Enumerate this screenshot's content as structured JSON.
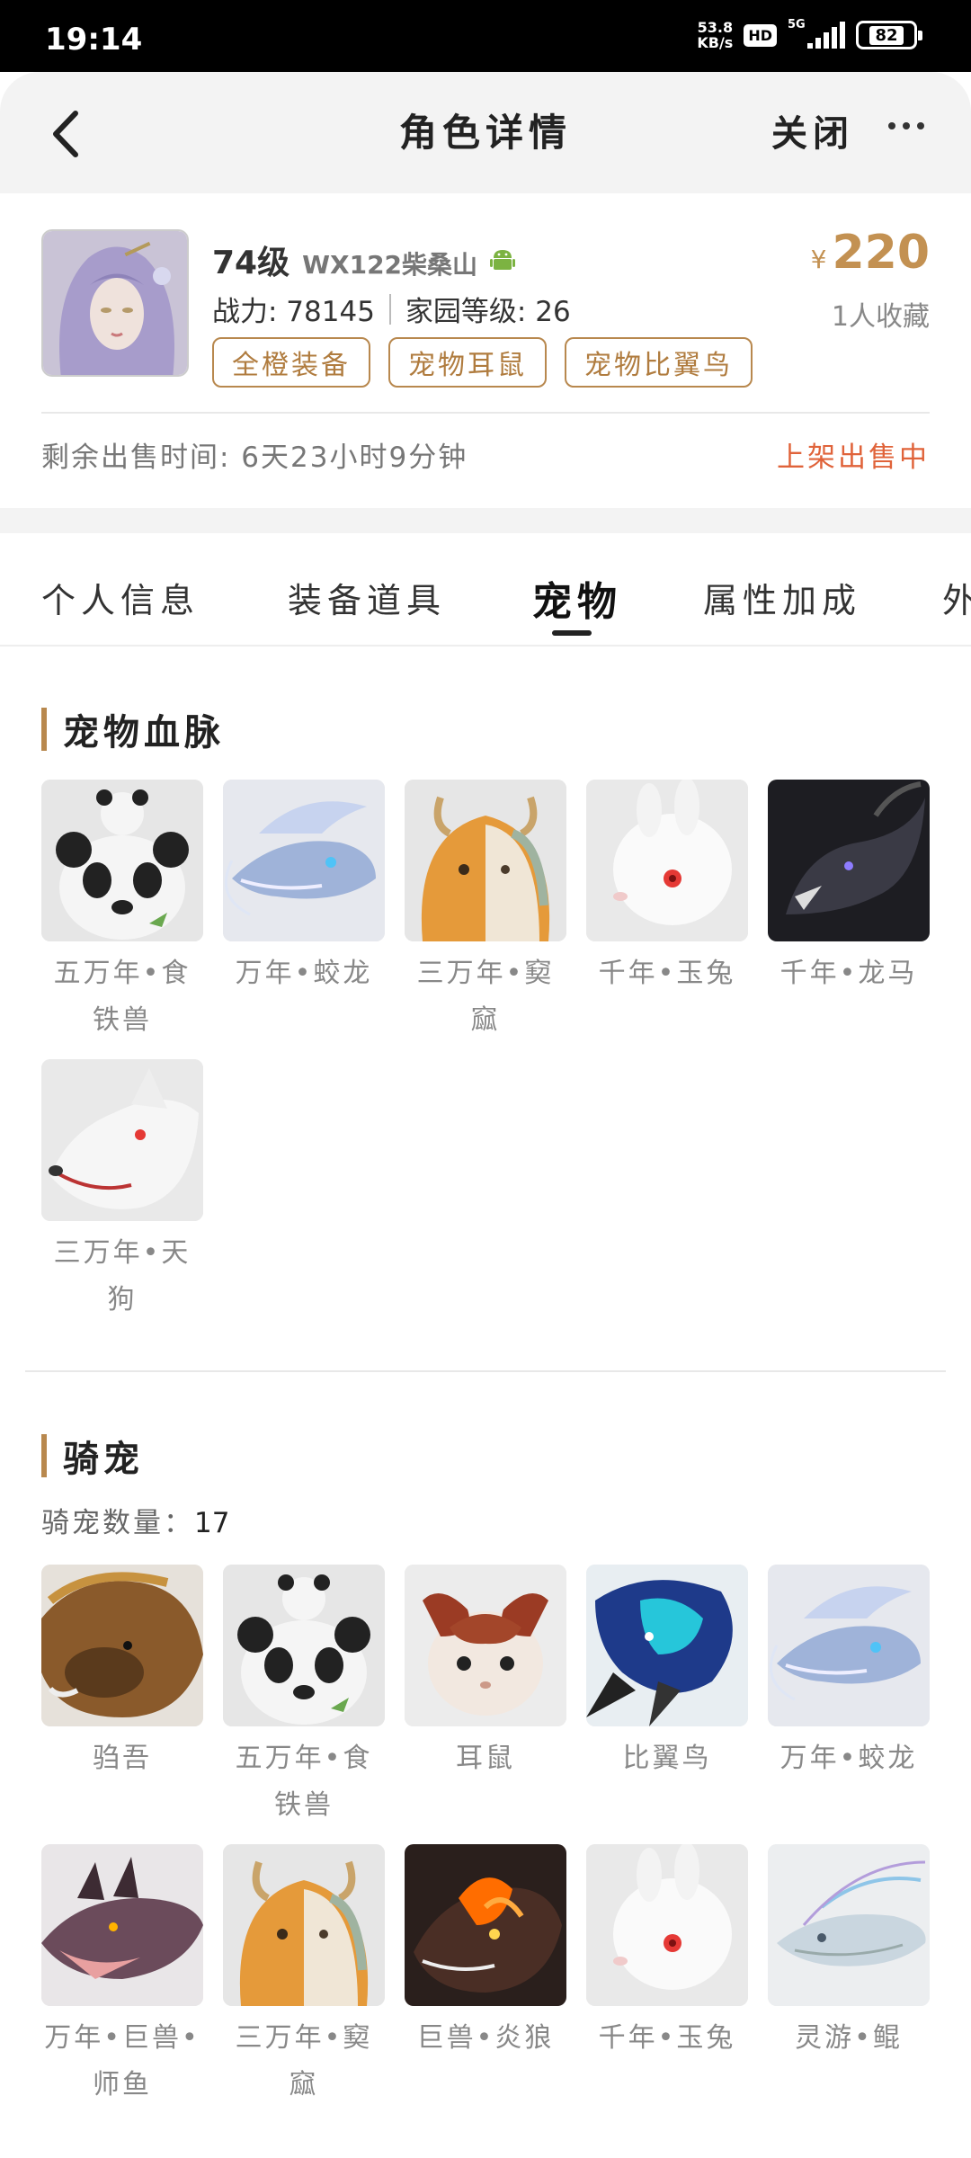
{
  "status_bar": {
    "time": "19:14",
    "net_speed": "53.8",
    "net_unit": "KB/s",
    "hd": "HD",
    "signal": "5G",
    "battery": "82"
  },
  "nav": {
    "title": "角色详情",
    "close": "关闭"
  },
  "role": {
    "level": "74级",
    "server": "WX122柴桑山",
    "power": "战力: 78145",
    "home_level": "家园等级: 26",
    "tags": [
      "全橙装备",
      "宠物耳鼠",
      "宠物比翼鸟"
    ],
    "currency": "¥",
    "price": "220",
    "favorites": "1人收藏",
    "remaining_time": "剩余出售时间: 6天23小时9分钟",
    "sale_status": "上架出售中"
  },
  "tabs": [
    "个人信息",
    "装备道具",
    "宠物",
    "属性加成",
    "外"
  ],
  "active_tab": 2,
  "bloodline": {
    "title": "宠物血脉",
    "pets": [
      {
        "name": "五万年•食铁兽",
        "icon": "panda-icon"
      },
      {
        "name": "万年•蛟龙",
        "icon": "dragon-icon"
      },
      {
        "name": "三万年•窫窳",
        "icon": "fox-mask-icon"
      },
      {
        "name": "千年•玉兔",
        "icon": "rabbit-icon"
      },
      {
        "name": "千年•龙马",
        "icon": "dark-dragon-icon"
      },
      {
        "name": "三万年•天狗",
        "icon": "wolf-icon"
      }
    ]
  },
  "mounts": {
    "title": "骑宠",
    "count_label": "骑宠数量：",
    "count": "17",
    "pets": [
      {
        "name": "驺吾",
        "icon": "boar-icon"
      },
      {
        "name": "五万年•食铁兽",
        "icon": "panda-icon"
      },
      {
        "name": "耳鼠",
        "icon": "mouse-icon"
      },
      {
        "name": "比翼鸟",
        "icon": "bird-icon"
      },
      {
        "name": "万年•蛟龙",
        "icon": "dragon-icon"
      },
      {
        "name": "万年•巨兽•师鱼",
        "icon": "lizard-icon"
      },
      {
        "name": "三万年•窫窳",
        "icon": "fox-mask-icon"
      },
      {
        "name": "巨兽•炎狼",
        "icon": "fire-wolf-icon"
      },
      {
        "name": "千年•玉兔",
        "icon": "rabbit-icon"
      },
      {
        "name": "灵游•鲲",
        "icon": "kun-fish-icon"
      }
    ]
  }
}
